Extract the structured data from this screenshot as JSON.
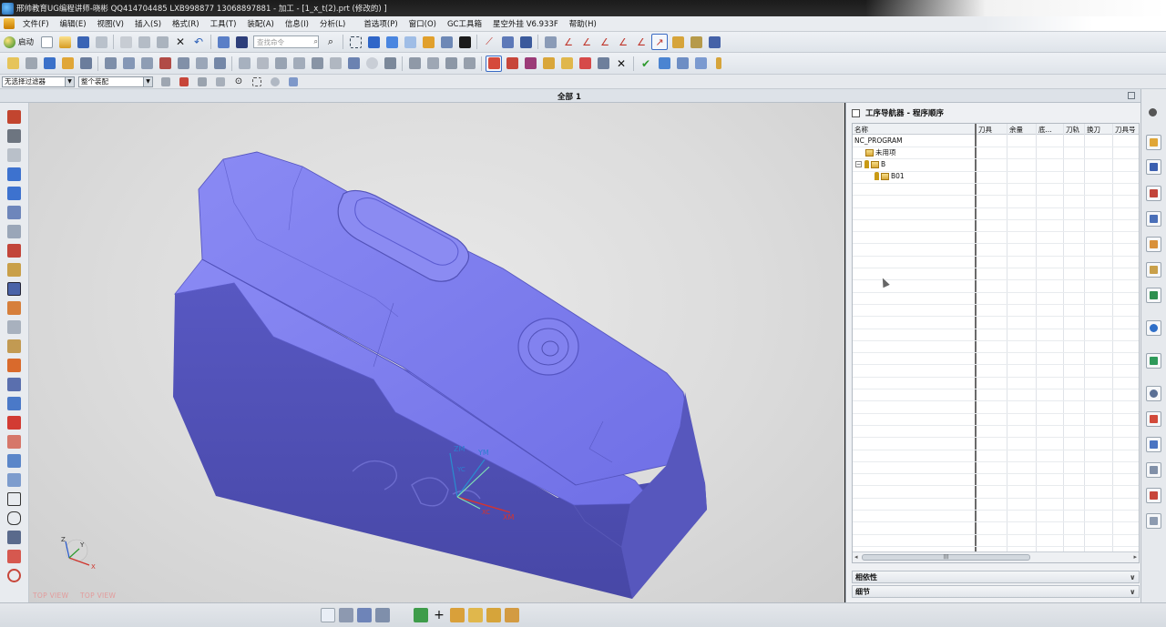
{
  "window": {
    "title": "邢帅教育UG编程讲师-晓彬  QQ414704485  LXB998877  13068897881 - 加工 - [1_x_t(2).prt (修改的) ]"
  },
  "menu": [
    "文件(F)",
    "编辑(E)",
    "视图(V)",
    "插入(S)",
    "格式(R)",
    "工具(T)",
    "装配(A)",
    "信息(I)",
    "分析(L)",
    "首选项(P)",
    "窗口(O)",
    "GC工具箱",
    "星空外挂 V6.933F",
    "帮助(H)"
  ],
  "toolbar": {
    "start_label": "启动",
    "search_placeholder": "查找命令"
  },
  "selection_bar": {
    "filter_value": "无选择过滤器",
    "scope_value": "整个装配"
  },
  "viewport": {
    "sheet_label": "全部 1",
    "view_labels": [
      "TOP VIEW",
      "TOP VIEW"
    ],
    "axis_labels": [
      "ZM",
      "YM",
      "YC",
      "XC",
      "XM"
    ],
    "triad_labels": [
      "Z",
      "Y",
      "X"
    ],
    "part_color": "#7878ee",
    "part_side_color": "#4f4fb0"
  },
  "navigator": {
    "title": "工序导航器 - 程序顺序",
    "columns": [
      "名称",
      "刀具",
      "余量",
      "底...",
      "刀轨",
      "换刀",
      "刀具号"
    ],
    "rows": [
      {
        "label": "NC_PROGRAM"
      },
      {
        "label": "未用项"
      },
      {
        "label": "B"
      },
      {
        "label": "B01"
      }
    ],
    "sections": [
      "相依性",
      "细节"
    ]
  }
}
